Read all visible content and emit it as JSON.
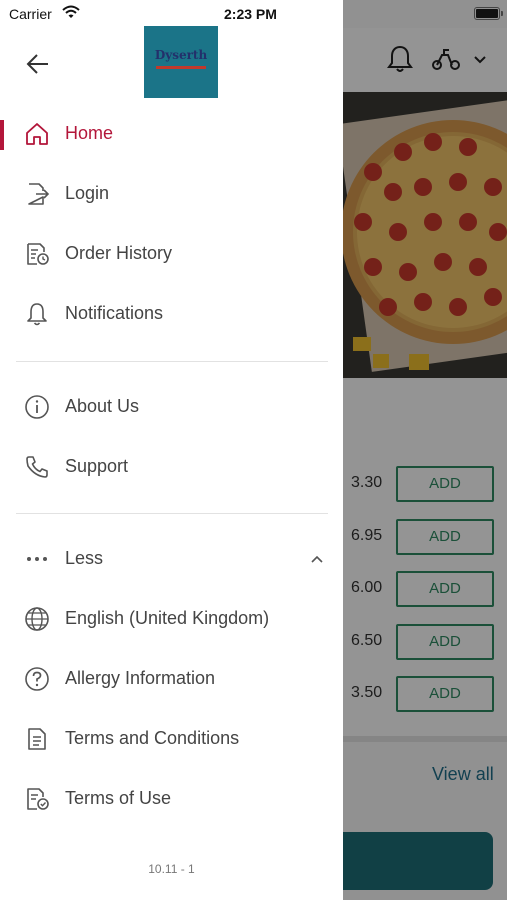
{
  "status_bar": {
    "carrier": "Carrier",
    "time": "2:23 PM"
  },
  "drawer": {
    "logo_text": "Dyserth",
    "menu_primary": [
      {
        "label": "Home",
        "icon": "home-icon",
        "active": true
      },
      {
        "label": "Login",
        "icon": "login-icon",
        "active": false
      },
      {
        "label": "Order History",
        "icon": "order-history-icon",
        "active": false
      },
      {
        "label": "Notifications",
        "icon": "bell-icon",
        "active": false
      }
    ],
    "menu_secondary": [
      {
        "label": "About Us",
        "icon": "info-icon"
      },
      {
        "label": "Support",
        "icon": "phone-icon"
      }
    ],
    "less_label": "Less",
    "menu_more": [
      {
        "label": "English (United Kingdom)",
        "icon": "globe-icon"
      },
      {
        "label": "Allergy Information",
        "icon": "question-icon"
      },
      {
        "label": "Terms and Conditions",
        "icon": "document-icon"
      },
      {
        "label": "Terms of Use",
        "icon": "document-check-icon"
      }
    ],
    "version": "10.11 - 1"
  },
  "background": {
    "prices": [
      "3.30",
      "6.95",
      "6.00",
      "6.50",
      "3.50"
    ],
    "add_label": "ADD",
    "view_all": "View all"
  },
  "colors": {
    "accent": "#b3163a",
    "text": "#444444",
    "add_green": "#2f8a62",
    "link_blue": "#1f6f8b",
    "logo_bg": "#1b7488"
  }
}
